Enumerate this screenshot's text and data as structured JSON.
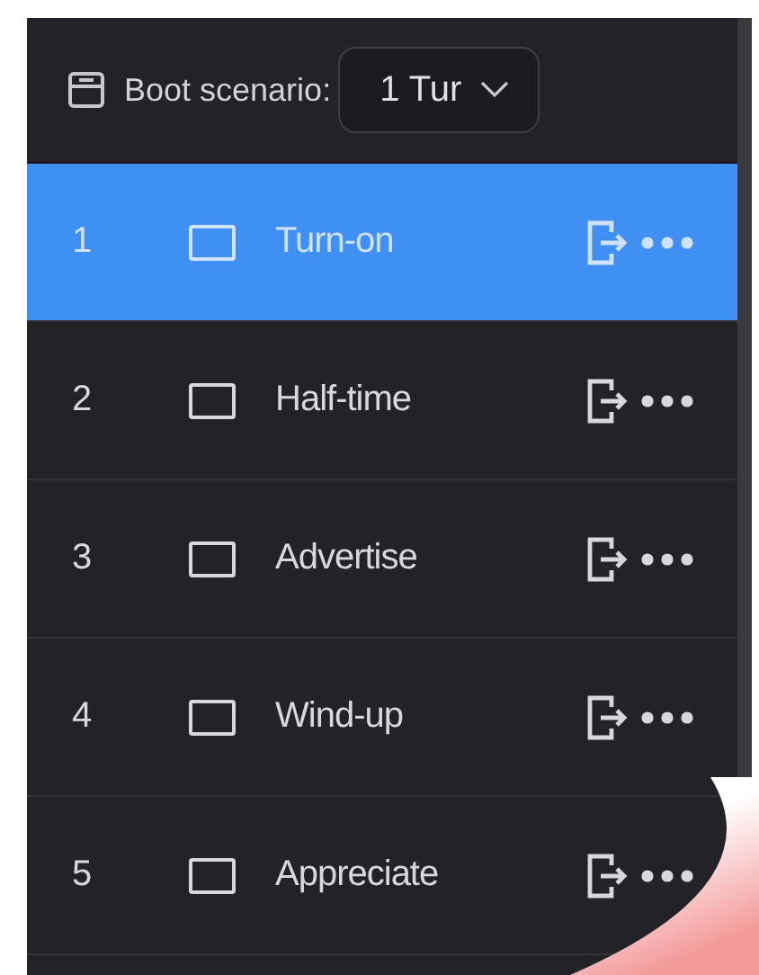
{
  "header": {
    "label": "Boot scenario:",
    "dropdown_value": "1 Tur"
  },
  "scenarios": [
    {
      "number": "1",
      "name": "Turn-on",
      "checked": false,
      "selected": true
    },
    {
      "number": "2",
      "name": "Half-time",
      "checked": false,
      "selected": false
    },
    {
      "number": "3",
      "name": "Advertise",
      "checked": false,
      "selected": false
    },
    {
      "number": "4",
      "name": "Wind-up",
      "checked": false,
      "selected": false
    },
    {
      "number": "5",
      "name": "Appreciate",
      "checked": false,
      "selected": false
    }
  ]
}
